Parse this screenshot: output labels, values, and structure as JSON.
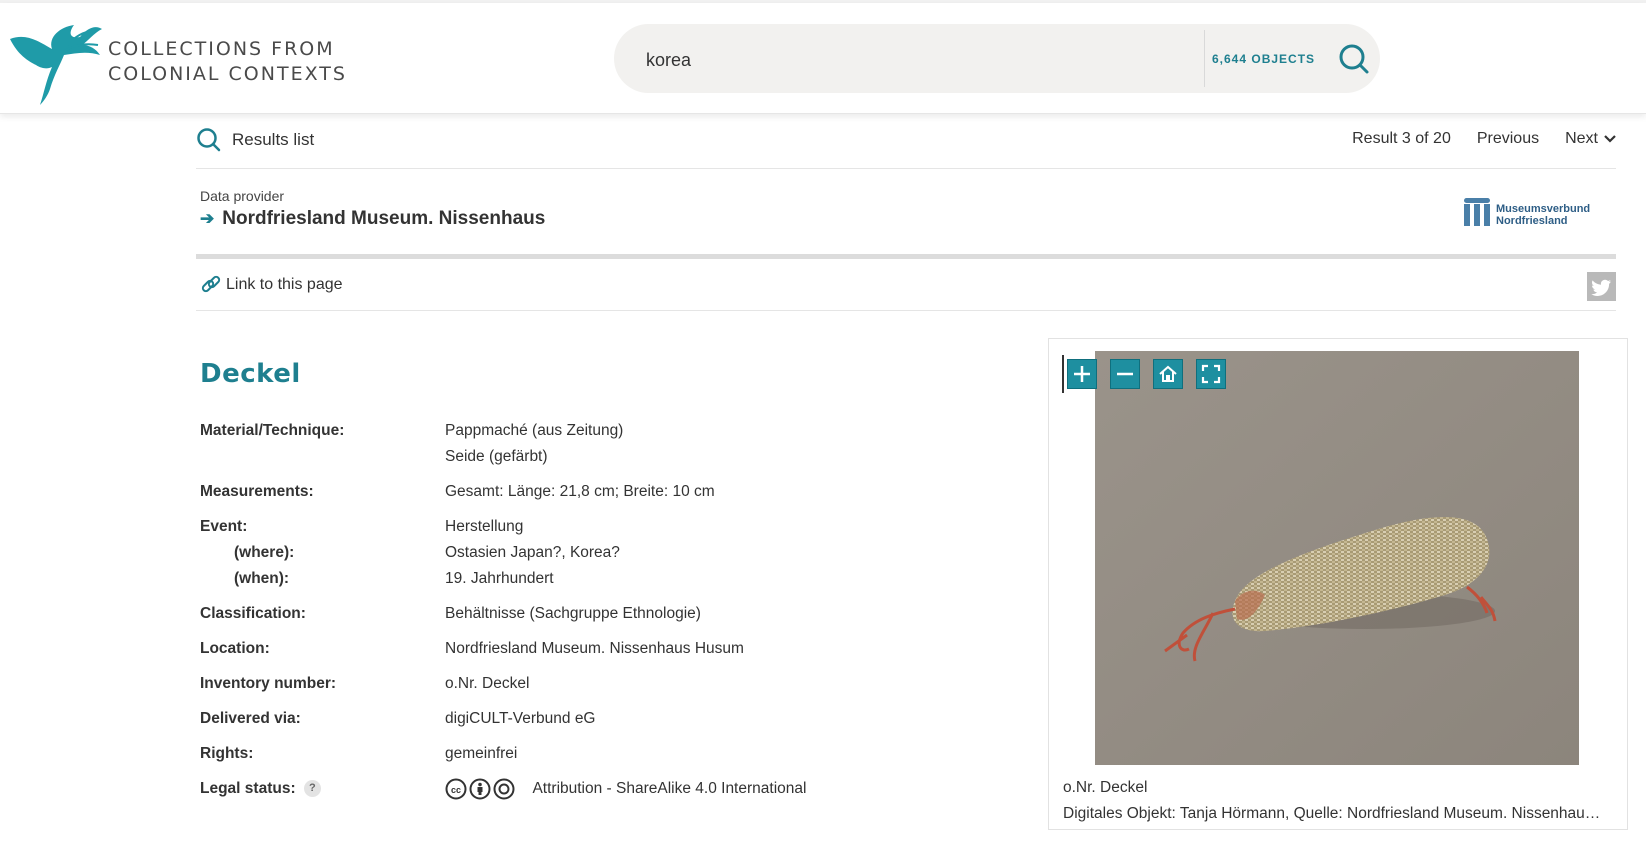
{
  "header": {
    "brand_line1": "COLLECTIONS FROM",
    "brand_line2": "COLONIAL CONTEXTS",
    "search_value": "korea",
    "object_count": "6,644 OBJECTS",
    "accent_color": "#1e7f8f"
  },
  "nav": {
    "results_list": "Results list",
    "result_position": "Result 3 of 20",
    "previous": "Previous",
    "next": "Next"
  },
  "provider": {
    "label": "Data provider",
    "name": "Nordfriesland Museum. Nissenhaus",
    "logo_line1": "Museumsverbund",
    "logo_line2": "Nordfriesland"
  },
  "link_to_page": "Link to this page",
  "object": {
    "title": "Deckel",
    "fields": {
      "material_label": "Material/Technique:",
      "material_1": "Pappmaché (aus Zeitung)",
      "material_2": "Seide (gefärbt)",
      "measurements_label": "Measurements:",
      "measurements": "Gesamt: Länge: 21,8 cm; Breite: 10 cm",
      "event_label": "Event:",
      "event": "Herstellung",
      "where_label": "(where):",
      "where": "Ostasien Japan?, Korea?",
      "when_label": "(when):",
      "when": "19. Jahrhundert",
      "classification_label": "Classification:",
      "classification": "Behältnisse (Sachgruppe Ethnologie)",
      "location_label": "Location:",
      "location": "Nordfriesland Museum. Nissenhaus Husum",
      "inventory_label": "Inventory number:",
      "inventory": "o.Nr. Deckel",
      "delivered_label": "Delivered via:",
      "delivered": "digiCULT-Verbund eG",
      "rights_label": "Rights:",
      "rights": "gemeinfrei",
      "legal_label": "Legal status:",
      "legal_help": "?",
      "legal": "Attribution - ShareAlike 4.0 International"
    }
  },
  "viewer": {
    "caption_1": "o.Nr. Deckel",
    "caption_2": "Digitales Objekt: Tanja Hörmann, Quelle: Nordfriesland Museum. Nissenhaus Husum"
  }
}
